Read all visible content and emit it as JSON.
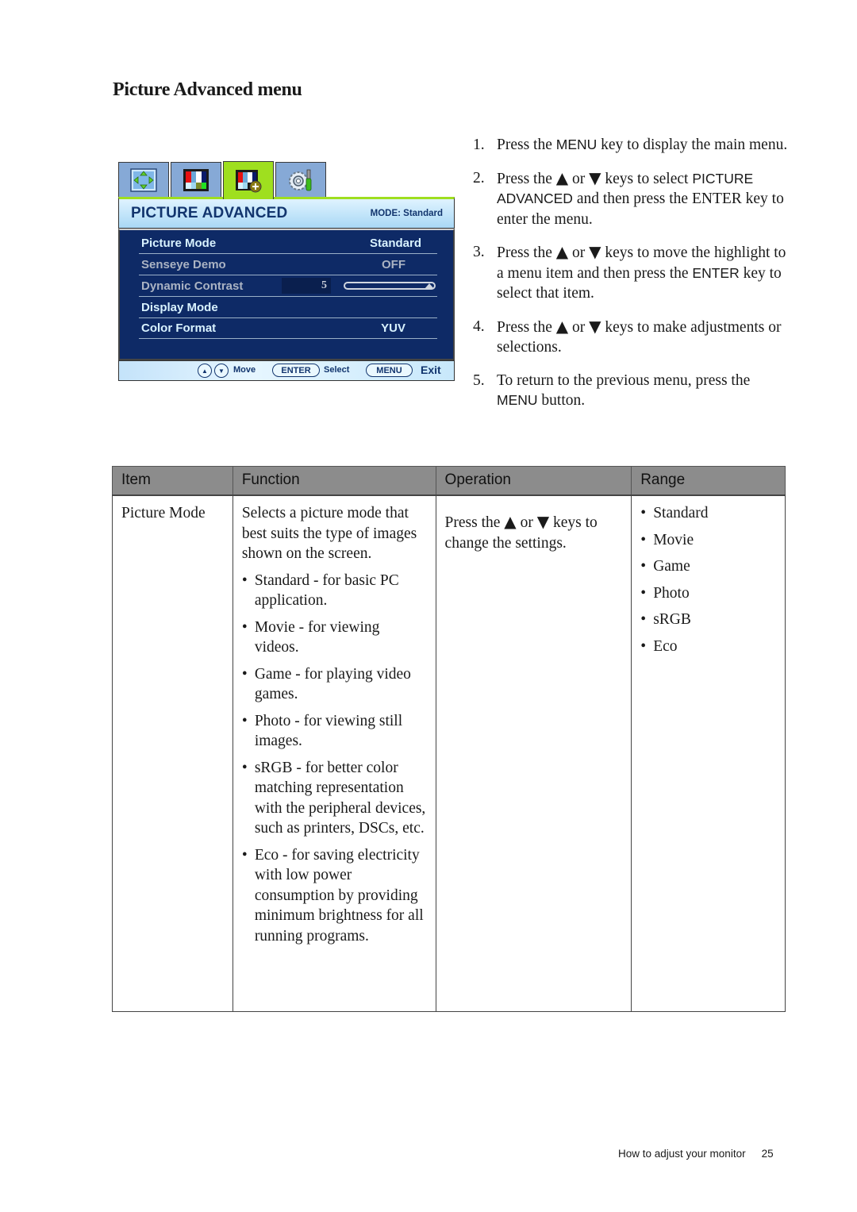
{
  "page_title": "Picture Advanced menu",
  "osd": {
    "tabs": [
      {
        "icon": "display-position-icon",
        "active": false
      },
      {
        "icon": "picture-color-bars-icon",
        "active": false
      },
      {
        "icon": "picture-advanced-icon",
        "active": true
      },
      {
        "icon": "system-settings-icon",
        "active": false
      }
    ],
    "header_title": "PICTURE ADVANCED",
    "mode_label": "MODE: Standard",
    "rows": [
      {
        "label": "Picture Mode",
        "value": "Standard",
        "style": "bright"
      },
      {
        "label": "Senseye Demo",
        "value": "OFF",
        "style": "dim"
      },
      {
        "label": "Dynamic Contrast",
        "value": "5",
        "style": "dim",
        "slider_fraction": 1.0
      },
      {
        "label": "Display Mode",
        "value": "",
        "style": "bright"
      },
      {
        "label": "Color Format",
        "value": "YUV",
        "style": "bright"
      }
    ],
    "footer": {
      "up_glyph": "▲",
      "down_glyph": "▼",
      "move_label": "Move",
      "enter_key": "ENTER",
      "select_label": "Select",
      "menu_key": "MENU",
      "exit_label": "Exit"
    }
  },
  "steps": [
    {
      "num": "1.",
      "parts": [
        {
          "t": "Press the "
        },
        {
          "k": "MENU"
        },
        {
          "t": " key to display the main menu."
        }
      ]
    },
    {
      "num": "2.",
      "parts": [
        {
          "t": "Press the "
        },
        {
          "a": "▲"
        },
        {
          "t": " or "
        },
        {
          "a": "▼"
        },
        {
          "t": " keys to select "
        },
        {
          "k": "PICTURE ADVANCED"
        },
        {
          "t": " and then press the ENTER key to enter the menu."
        }
      ]
    },
    {
      "num": "3.",
      "parts": [
        {
          "t": "Press the "
        },
        {
          "a": "▲"
        },
        {
          "t": " or "
        },
        {
          "a": "▼"
        },
        {
          "t": " keys to move the highlight to a menu item and then press the "
        },
        {
          "k": "ENTER"
        },
        {
          "t": " key to select that item."
        }
      ]
    },
    {
      "num": "4.",
      "parts": [
        {
          "t": "Press the "
        },
        {
          "a": "▲"
        },
        {
          "t": " or "
        },
        {
          "a": "▼"
        },
        {
          "t": " keys to make adjustments or selections."
        }
      ]
    },
    {
      "num": "5.",
      "parts": [
        {
          "t": "To return to the previous menu, press the "
        },
        {
          "k": "MENU"
        },
        {
          "t": " button."
        }
      ]
    }
  ],
  "table": {
    "headers": [
      "Item",
      "Function",
      "Operation",
      "Range"
    ],
    "rows": [
      {
        "item": "Picture Mode",
        "function_intro": "Selects a picture mode that best suits the type of images shown on the screen.",
        "function_bullets": [
          "Standard - for basic PC application.",
          "Movie - for viewing videos.",
          "Game - for playing video games.",
          "Photo - for viewing still images.",
          "sRGB - for better color matching representation with the peripheral devices, such as printers, DSCs, etc.",
          "Eco - for saving electricity with low power consumption by providing minimum brightness for all running programs."
        ],
        "operation_parts": [
          {
            "t": "Press the "
          },
          {
            "a": "▲"
          },
          {
            "t": " or "
          },
          {
            "a": "▼"
          },
          {
            "t": " keys to change the settings."
          }
        ],
        "range": [
          "Standard",
          "Movie",
          "Game",
          "Photo",
          "sRGB",
          "Eco"
        ]
      }
    ]
  },
  "footer": {
    "section": "How to adjust your monitor",
    "page_number": "25"
  },
  "colors": {
    "osd_body": "#0e2a66",
    "osd_active_tab": "#9fdf1f",
    "osd_tab": "#86a9d6",
    "osd_text_bright": "#d8f2ff",
    "osd_text_dim": "#aab3c3",
    "table_header": "#8c8c8c"
  }
}
